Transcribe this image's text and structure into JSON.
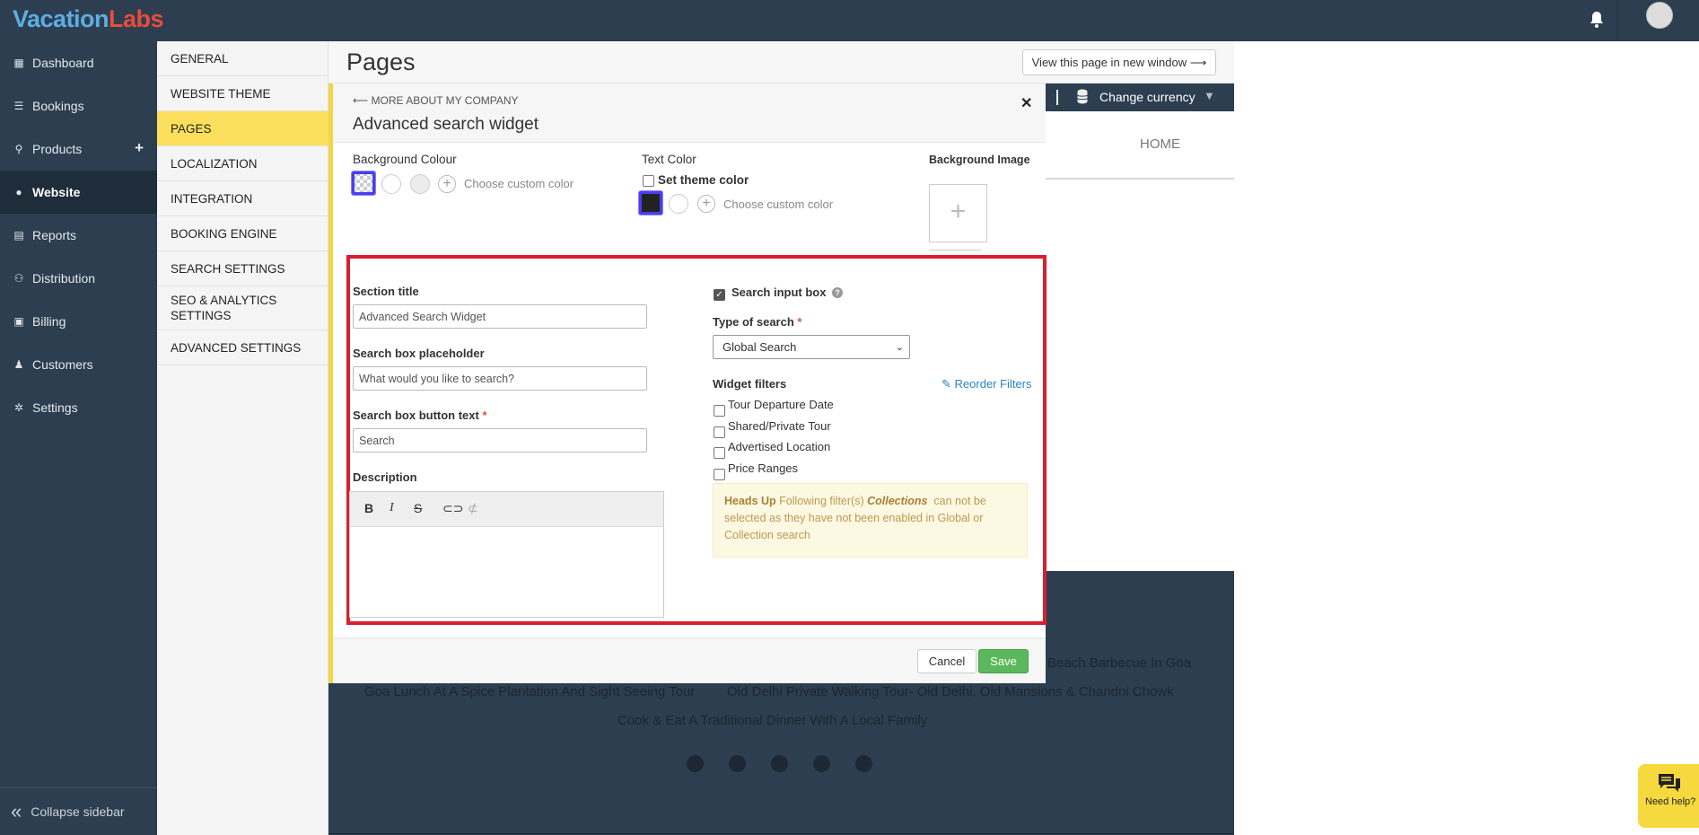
{
  "app": {
    "logo_part1": "Vacation",
    "logo_part2": "Labs"
  },
  "sidebar": {
    "items": [
      {
        "label": "Dashboard",
        "icon": "dashboard-icon"
      },
      {
        "label": "Bookings",
        "icon": "list-icon"
      },
      {
        "label": "Products",
        "icon": "map-pin-icon"
      },
      {
        "label": "Website",
        "icon": "globe-icon"
      },
      {
        "label": "Reports",
        "icon": "report-icon"
      },
      {
        "label": "Distribution",
        "icon": "users-icon"
      },
      {
        "label": "Billing",
        "icon": "money-icon"
      },
      {
        "label": "Customers",
        "icon": "user-icon"
      },
      {
        "label": "Settings",
        "icon": "gear-icon"
      }
    ],
    "active": "Website",
    "collapse_label": "Collapse sidebar"
  },
  "submenu": {
    "items": [
      "GENERAL",
      "WEBSITE THEME",
      "PAGES",
      "LOCALIZATION",
      "INTEGRATION",
      "BOOKING ENGINE",
      "SEARCH SETTINGS",
      "SEO & ANALYTICS SETTINGS",
      "ADVANCED SETTINGS"
    ],
    "active": "PAGES"
  },
  "page": {
    "title": "Pages",
    "view_button": "View this page in new window ⟶"
  },
  "preview": {
    "currency": "Change currency",
    "nav_home": "HOME"
  },
  "footer": {
    "line1": "Beach Barbecue In Goa",
    "line2a": "Goa Lunch At A Spice Plantation And Sight Seeing Tour",
    "line2b": "Old Delhi Private Walking Tour- Old Delhi, Old Mansions & Chandni Chowk",
    "line3": "Cook & Eat A Traditional Dinner With A Local Family"
  },
  "modal": {
    "back_link": "⟵ MORE ABOUT MY COMPANY",
    "title": "Advanced search widget",
    "bg_colour_label": "Background Colour",
    "choose_custom": "Choose custom color",
    "text_color_label": "Text Color",
    "set_theme_color": "Set theme color",
    "bg_image_label": "Background Image",
    "section_title_label": "Section title",
    "section_title_value": "Advanced Search Widget",
    "placeholder_label": "Search box placeholder",
    "placeholder_value": "What would you like to search?",
    "button_text_label": "Search box button text",
    "required_mark": "*",
    "button_text_value": "Search",
    "description_label": "Description",
    "search_input_box": "Search input box",
    "search_input_checked": true,
    "type_of_search_label": "Type of search",
    "type_of_search_value": "Global Search",
    "widget_filters_label": "Widget filters",
    "reorder_filters": "Reorder Filters",
    "filters": [
      "Tour Departure Date",
      "Shared/Private Tour",
      "Advertised Location",
      "Price Ranges"
    ],
    "headsup_title": "Heads Up",
    "headsup_pre": "Following filter(s)",
    "headsup_em": "Collections",
    "headsup_post": "can not be selected as they have not been enabled in Global or Collection search",
    "cancel": "Cancel",
    "save": "Save"
  },
  "help": {
    "label": "Need help?"
  },
  "colors": {
    "accent": "#fcdf5c",
    "sidebar_bg": "#2c3e50",
    "highlight_box": "#d62030",
    "save_green": "#5cb85c",
    "swatch_selected": "#4a3df2"
  }
}
